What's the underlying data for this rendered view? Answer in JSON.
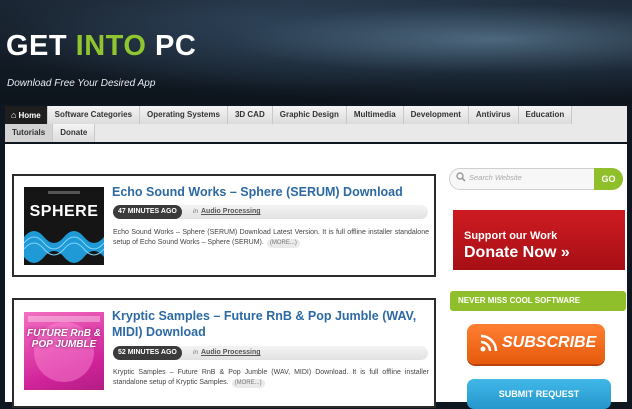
{
  "site": {
    "logo_pre": "GET ",
    "logo_mid": "INTO",
    "logo_post": " PC",
    "tagline": "Download Free Your Desired App",
    "accent_color": "#8fc52f"
  },
  "nav": {
    "row1": [
      {
        "label": "Home",
        "icon": "home-icon",
        "active": true
      },
      {
        "label": "Software Categories"
      },
      {
        "label": "Operating Systems"
      },
      {
        "label": "3D CAD"
      },
      {
        "label": "Graphic Design"
      },
      {
        "label": "Multimedia"
      },
      {
        "label": "Development"
      },
      {
        "label": "Antivirus"
      },
      {
        "label": "Education"
      }
    ],
    "row2": [
      {
        "label": "Tutorials"
      },
      {
        "label": "Donate"
      }
    ]
  },
  "posts": [
    {
      "title": "Echo Sound Works – Sphere (SERUM) Download",
      "time": "47 MINUTES AGO",
      "in_label": "in",
      "category": "Audio Processing",
      "excerpt": "Echo Sound Works – Sphere (SERUM) Download Latest Version. It is full offline installer standalone setup of Echo Sound Works – Sphere (SERUM).",
      "more": "(MORE...)",
      "thumb_text": "SPHERE"
    },
    {
      "title": "Kryptic Samples – Future RnB & Pop Jumble (WAV, MIDI) Download",
      "time": "52 MINUTES AGO",
      "in_label": "in",
      "category": "Audio Processing",
      "excerpt": "Kryptic Samples – Future RnB & Pop Jumble (WAV, MIDI) Download. It is full offline installer standalone setup of Kryptic Samples.",
      "more": "(MORE...)",
      "thumb_text": "FUTURE RnB & POP JUMBLE"
    }
  ],
  "sidebar": {
    "search_placeholder": "Search Website",
    "go_label": "GO",
    "support_line1": "Support our Work",
    "support_line2": "Donate Now »",
    "never_miss": "NEVER MISS COOL SOFTWARE",
    "subscribe": "SUBSCRIBE",
    "submit_request": "SUBMIT REQUEST"
  }
}
